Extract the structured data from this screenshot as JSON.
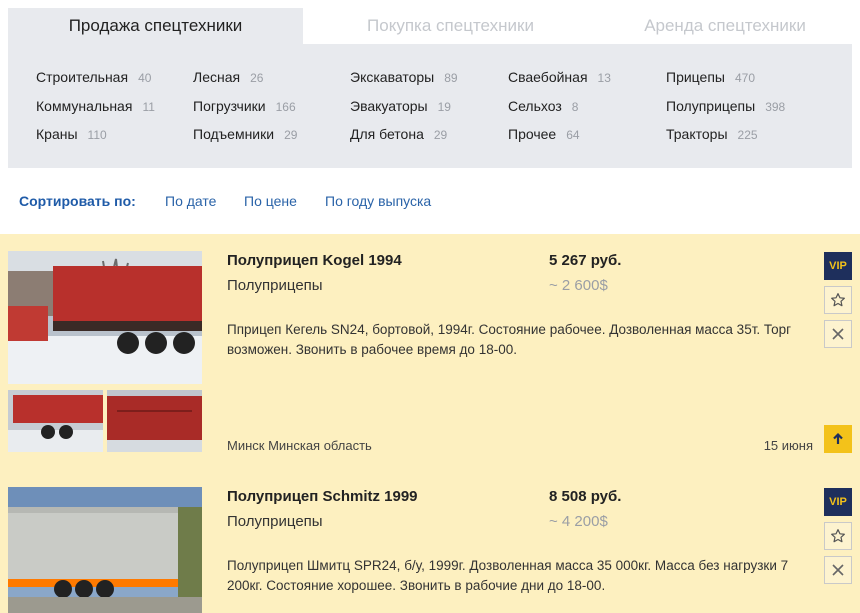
{
  "tabs": [
    {
      "label": "Продажа спецтехники",
      "active": true
    },
    {
      "label": "Покупка спецтехники",
      "active": false
    },
    {
      "label": "Аренда спецтехники",
      "active": false
    }
  ],
  "categories": [
    [
      {
        "name": "Строительная",
        "count": "40"
      },
      {
        "name": "Коммунальная",
        "count": "11"
      },
      {
        "name": "Краны",
        "count": "110"
      }
    ],
    [
      {
        "name": "Лесная",
        "count": "26"
      },
      {
        "name": "Погрузчики",
        "count": "166"
      },
      {
        "name": "Подъемники",
        "count": "29"
      }
    ],
    [
      {
        "name": "Экскаваторы",
        "count": "89"
      },
      {
        "name": "Эвакуаторы",
        "count": "19"
      },
      {
        "name": "Для бетона",
        "count": "29"
      }
    ],
    [
      {
        "name": "Сваебойная",
        "count": "13"
      },
      {
        "name": "Сельхоз",
        "count": "8"
      },
      {
        "name": "Прочее",
        "count": "64"
      }
    ],
    [
      {
        "name": "Прицепы",
        "count": "470"
      },
      {
        "name": "Полуприцепы",
        "count": "398"
      },
      {
        "name": "Тракторы",
        "count": "225"
      }
    ]
  ],
  "sort": {
    "label": "Сортировать по:",
    "options": [
      "По дате",
      "По цене",
      "По году выпуска"
    ]
  },
  "listings": [
    {
      "title": "Полуприцеп Kogel 1994",
      "category": "Полуприцепы",
      "price": "5 267 руб.",
      "price_usd": "~ 2 600$",
      "description": "Пприцеп Кегель SN24, бортовой, 1994г. Состояние рабочее. Дозволенная масса 35т. Торг возможен. Звонить в рабочее время до 18-00.",
      "location": "Минск Минская область",
      "date": "15 июня",
      "badge": "VIP"
    },
    {
      "title": "Полуприцеп Schmitz 1999",
      "category": "Полуприцепы",
      "price": "8 508 руб.",
      "price_usd": "~ 4 200$",
      "description": "Полуприцеп Шмитц SPR24, б/у, 1999г. Дозволенная масса 35 000кг. Масса без нагрузки 7 200кг. Состояние хорошее. Звонить в рабочие дни до 18-00.",
      "badge": "VIP"
    }
  ],
  "icons": {
    "favorite": "star-icon",
    "hide": "close-icon",
    "raise": "arrow-up-icon"
  },
  "colors": {
    "listing_bg": "#fdf0c0",
    "panel_bg": "#e8eaee",
    "link": "#2a63a8",
    "vip_bg": "#1e2f5c",
    "vip_text": "#f3c21a",
    "raise_bg": "#f3c21a"
  }
}
